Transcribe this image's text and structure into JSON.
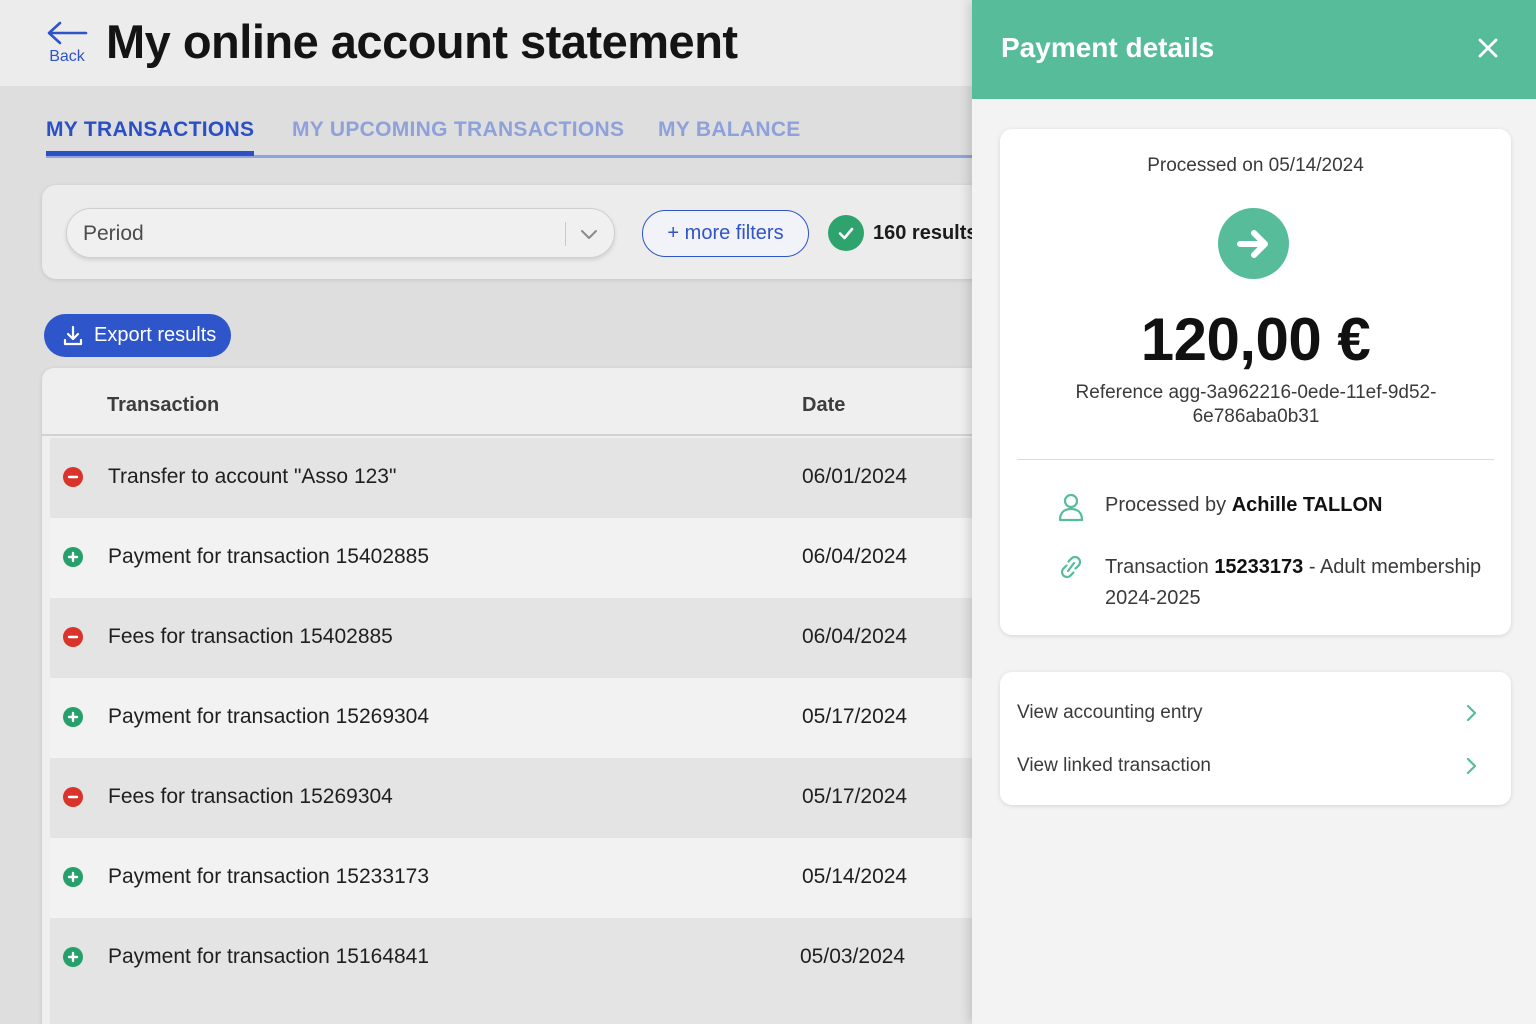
{
  "header": {
    "back_label": "Back",
    "title": "My online account statement"
  },
  "tabs": [
    {
      "label": "MY TRANSACTIONS",
      "active": true
    },
    {
      "label": "MY UPCOMING TRANSACTIONS",
      "active": false
    },
    {
      "label": "MY BALANCE",
      "active": false
    }
  ],
  "filters": {
    "period_placeholder": "Period",
    "more_filters_label": "+ more filters",
    "results_text": "160 results"
  },
  "export": {
    "label": "Export results"
  },
  "table": {
    "columns": [
      "Transaction",
      "Date"
    ],
    "rows": [
      {
        "type": "debit",
        "label": "Transfer to account \"Asso 123\"",
        "date": "06/01/2024"
      },
      {
        "type": "credit",
        "label": "Payment for transaction 15402885",
        "date": "06/04/2024"
      },
      {
        "type": "debit",
        "label": "Fees for transaction 15402885",
        "date": "06/04/2024"
      },
      {
        "type": "credit",
        "label": "Payment for transaction 15269304",
        "date": "05/17/2024"
      },
      {
        "type": "debit",
        "label": "Fees for transaction 15269304",
        "date": "05/17/2024"
      },
      {
        "type": "credit",
        "label": "Payment for transaction 15233173",
        "date": "05/14/2024"
      },
      {
        "type": "credit",
        "label": "Payment for transaction 15164841",
        "date": "05/03/2024"
      }
    ]
  },
  "drawer": {
    "title": "Payment details",
    "processed_on": "Processed on 05/14/2024",
    "amount": "120,00 €",
    "reference": "Reference agg-3a962216-0ede-11ef-9d52-6e786aba0b31",
    "processed_by_prefix": "Processed by ",
    "processed_by_name": "Achille TALLON",
    "transaction_prefix": "Transaction ",
    "transaction_id": "15233173",
    "transaction_suffix": " - Adult membership 2024-2025",
    "links": [
      "View accounting entry",
      "View linked transaction"
    ]
  },
  "colors": {
    "accent_blue": "#2e55c9",
    "drawer_green": "#57bc9a",
    "credit_green": "#25a06a",
    "debit_red": "#d9342b"
  },
  "icons": {
    "back": "arrow-left-icon",
    "close": "close-icon",
    "dropdown": "chevron-down-icon",
    "results": "check-icon",
    "export": "download-icon",
    "credit": "plus-circle-icon",
    "debit": "minus-circle-icon",
    "payment": "arrow-right-icon",
    "person": "person-icon",
    "link": "link-icon",
    "chevron": "chevron-right-icon"
  }
}
